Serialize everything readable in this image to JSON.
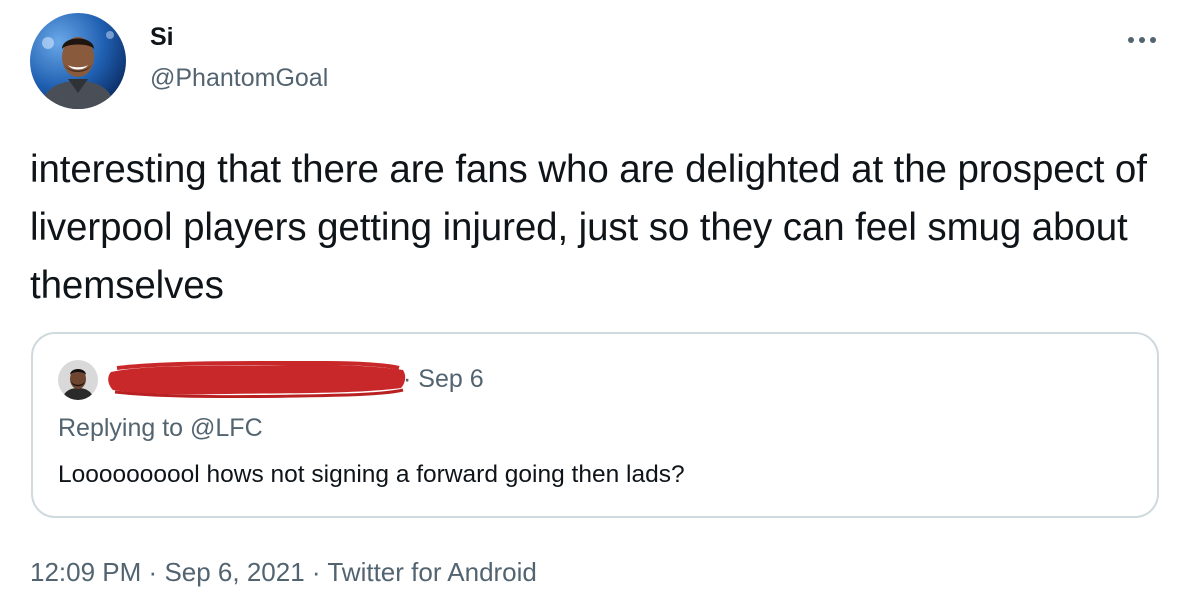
{
  "user": {
    "display_name": "Si",
    "handle": "@PhantomGoal",
    "avatar_icon": "profile-photo"
  },
  "tweet": {
    "text": "interesting that there are fans who are delighted at the prospect of liverpool players getting injured, just so they can feel smug about themselves"
  },
  "quoted_tweet": {
    "author_redacted": true,
    "separator": "·",
    "date": "Sep 6",
    "replying_to": "Replying to @LFC",
    "text": "Loooooooool hows not signing a forward going then lads?"
  },
  "meta": {
    "time": "12:09 PM",
    "separator": "·",
    "date": "Sep 6, 2021",
    "source": "Twitter for Android"
  },
  "colors": {
    "text": "#0f1419",
    "secondary": "#536471",
    "border": "#cfd9de",
    "redaction": "#c8282a"
  },
  "icons": {
    "more": "more-horizontal-icon"
  }
}
